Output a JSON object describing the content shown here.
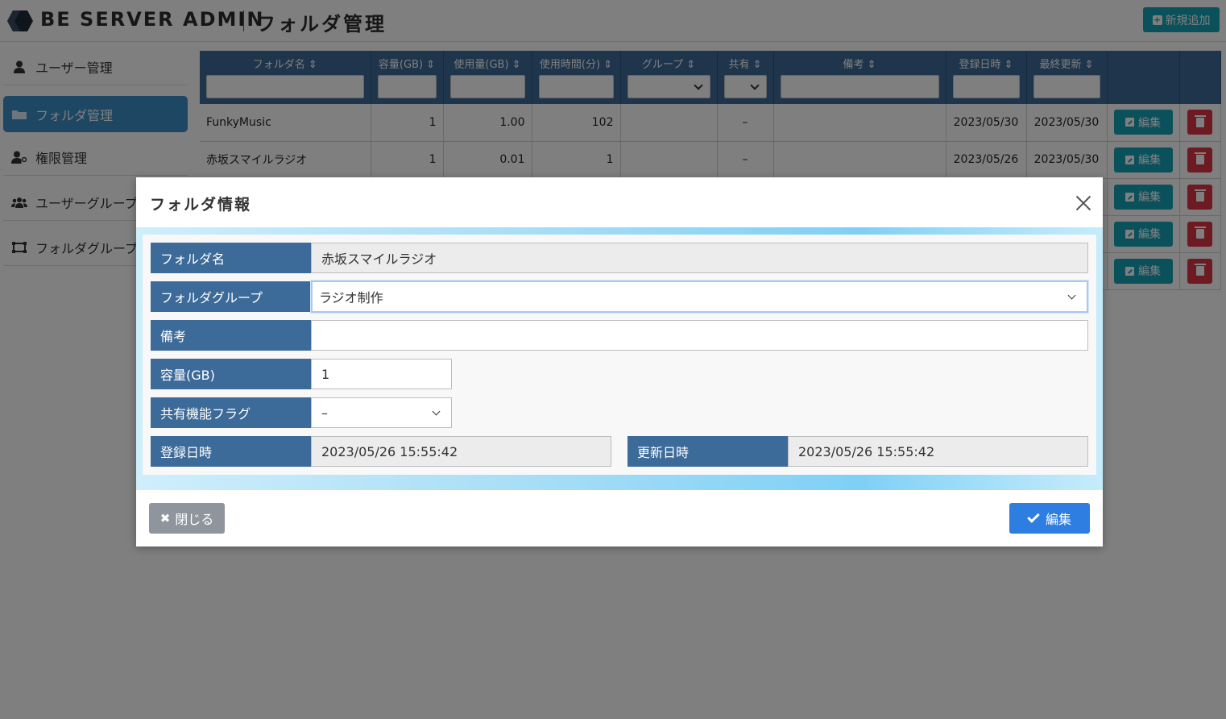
{
  "header": {
    "app_title": "BE SERVER ADMIN",
    "page_title": "フォルダ管理",
    "add_button": "新規追加"
  },
  "sidebar": {
    "items": [
      {
        "label": "ユーザー管理",
        "icon": "user-icon"
      },
      {
        "label": "フォルダ管理",
        "icon": "folder-icon",
        "active": true
      },
      {
        "label": "権限管理",
        "icon": "user-key-icon"
      },
      {
        "label": "ユーザーグループ",
        "icon": "users-icon"
      },
      {
        "label": "フォルダグループ",
        "icon": "folder-group-icon"
      }
    ]
  },
  "table": {
    "columns": [
      "フォルダ名",
      "容量(GB)",
      "使用量(GB)",
      "使用時間(分)",
      "グループ",
      "共有",
      "備考",
      "登録日時",
      "最終更新"
    ],
    "rows": [
      {
        "name": "FunkyMusic",
        "capacity": "1",
        "usage": "1.00",
        "time": "102",
        "group": "",
        "share": "–",
        "note": "",
        "created": "2023/05/30",
        "updated": "2023/05/30"
      },
      {
        "name": "赤坂スマイルラジオ",
        "capacity": "1",
        "usage": "0.01",
        "time": "1",
        "group": "",
        "share": "–",
        "note": "",
        "created": "2023/05/26",
        "updated": "2023/05/30"
      }
    ],
    "edit_label": "編集"
  },
  "modal": {
    "title": "フォルダ情報",
    "fields": {
      "folder_name_label": "フォルダ名",
      "folder_name_value": "赤坂スマイルラジオ",
      "folder_group_label": "フォルダグループ",
      "folder_group_value": "ラジオ制作",
      "note_label": "備考",
      "note_value": "",
      "capacity_label": "容量(GB)",
      "capacity_value": "1",
      "share_label": "共有機能フラグ",
      "share_value": "–",
      "created_label": "登録日時",
      "created_value": "2023/05/26 15:55:42",
      "updated_label": "更新日時",
      "updated_value": "2023/05/26 15:55:42"
    },
    "close_button": "閉じる",
    "edit_button": "編集"
  },
  "colors": {
    "header_blue": "#3c6a99",
    "teal": "#17a2b8",
    "danger": "#dc3545",
    "primary": "#2e7de0",
    "secondary": "#8e959d"
  }
}
